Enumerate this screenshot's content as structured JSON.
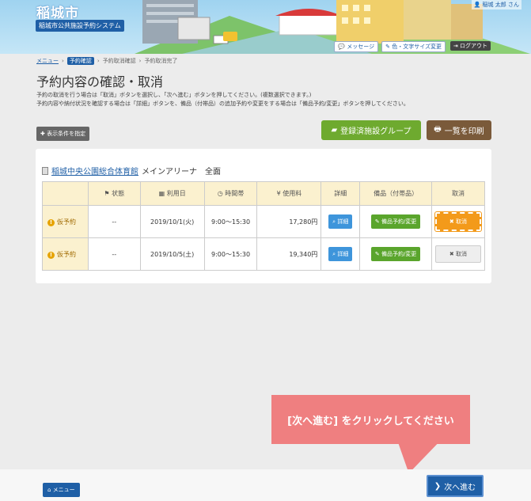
{
  "header": {
    "city_name": "稲城市",
    "system_name": "稲城市公共施設予約システム",
    "user": "稲城 太郎 さん",
    "message_label": "メッセージ",
    "color_text_label": "色・文字サイズ変更",
    "logout_label": "ログアウト"
  },
  "breadcrumb": {
    "items": [
      "メニュー",
      "予約確認",
      "予約取消確認",
      "予約取消完了"
    ]
  },
  "page": {
    "title": "予約内容の確認・取消",
    "description_line1": "予約の取消を行う場合は「取消」ボタンを選択し、「次へ進む」ボタンを押してください。(複数選択できます。)",
    "description_line2": "予約内容や納付状況を確認する場合は「詳細」ボタンを、備品（付帯品）の追加予約や変更をする場合は「備品予約/変更」ボタンを押してください。"
  },
  "toolbar": {
    "filter_label": "表示条件を指定",
    "group_label": "登録済施設グループ",
    "print_label": "一覧を印刷"
  },
  "facility": {
    "name": "稲城中央公園総合体育館",
    "room": "メインアリーナ　全面"
  },
  "table": {
    "headers": [
      "状態",
      "利用日",
      "時間帯",
      "使用料",
      "詳細",
      "備品（付帯品）",
      "取消"
    ],
    "rows": [
      {
        "type": "仮予約",
        "status": "--",
        "date": "2019/10/1(火)",
        "time": "9:00～15:30",
        "fee": "17,280円",
        "detail": "詳細",
        "equipment": "備品予約/変更",
        "cancel": "取消"
      },
      {
        "type": "仮予約",
        "status": "--",
        "date": "2019/10/5(土)",
        "time": "9:00～15:30",
        "fee": "19,340円",
        "detail": "詳細",
        "equipment": "備品予約/変更",
        "cancel": "取消"
      }
    ]
  },
  "callout": {
    "text": "[次へ進む] をクリックしてください"
  },
  "footer": {
    "menu_label": "メニュー",
    "next_label": "次へ進む"
  }
}
